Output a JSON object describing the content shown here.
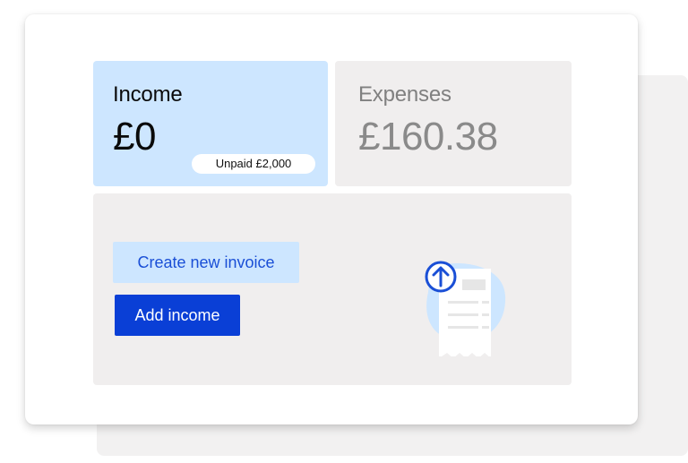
{
  "income": {
    "title": "Income",
    "amount": "£0",
    "unpaid_badge": "Unpaid £2,000"
  },
  "expenses": {
    "title": "Expenses",
    "amount": "£160.38"
  },
  "actions": {
    "create_invoice_label": "Create new invoice",
    "add_income_label": "Add income"
  },
  "illustration": {
    "icon": "receipt-upload-icon"
  },
  "colors": {
    "income_tile": "#cde6ff",
    "neutral_tile": "#f0eeee",
    "primary_button": "#0a3fd6",
    "secondary_button": "#cde6ff",
    "accent_blue": "#1a4fd6"
  }
}
